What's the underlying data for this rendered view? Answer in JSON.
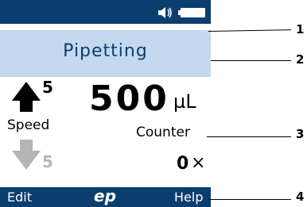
{
  "screen": {
    "title": "Pipetting",
    "speed": {
      "label": "Speed",
      "aspirate_level": "5",
      "dispense_level": "5"
    },
    "volume": {
      "value": "500",
      "unit": "µL"
    },
    "counter": {
      "label": "Counter",
      "value": "0",
      "suffix": "×"
    },
    "status_icons": [
      "speaker-icon",
      "battery-icon"
    ]
  },
  "softkeys": {
    "left": "Edit",
    "center": "ep",
    "right": "Help"
  },
  "callouts": [
    "1",
    "2",
    "3",
    "4"
  ],
  "colors": {
    "bar": "#0b3e6f",
    "title_bg": "#c5d9ee",
    "inactive": "#b5b5b5"
  }
}
